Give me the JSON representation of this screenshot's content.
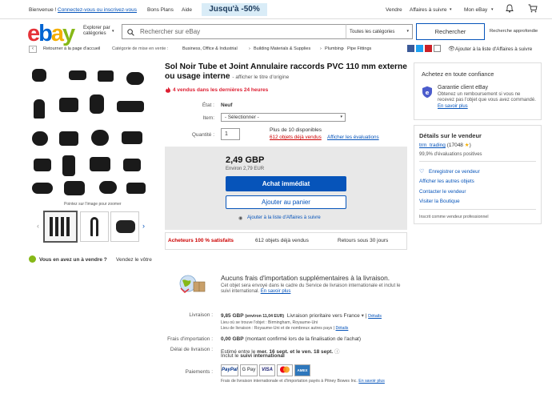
{
  "topbar": {
    "greeting": "Bienvenue !",
    "signin_link": "Connectez-vous ou inscrivez-vous",
    "deals": "Bons Plans",
    "help": "Aide",
    "promo": "Jusqu'à -50%",
    "sell": "Vendre",
    "watchlist": "Affaires à suivre",
    "my_ebay": "Mon eBay"
  },
  "header": {
    "logo": "ebay",
    "explore": "Explorer par catégories",
    "search_placeholder": "Rechercher sur eBay",
    "category": "Toutes les catégories",
    "search_button": "Rechercher",
    "advanced": "Recherche approfondie"
  },
  "breadcrumb": {
    "back": "Retourner à la page d'accueil",
    "prefix": "Catégorie de mise en vente :",
    "items": [
      "Business, Office & Industrial",
      "Building Materials & Supplies",
      "Plumbing",
      "Pipe Fittings"
    ],
    "add_watch": "Ajouter à la liste d'Affaires à suivre"
  },
  "gallery": {
    "zoom_hint": "Pointez sur l'image pour zoomer",
    "sell_question": "Vous en avez un à vendre ?",
    "sell_link": "Vendez le vôtre"
  },
  "item": {
    "title": "Sol Noir Tube et Joint Annulaire raccords PVC 110 mm externe ou usage interne",
    "show_title": "- afficher le titre d'origine",
    "sold_recent": "4 vendus dans les dernières 24 heures",
    "condition_label": "État :",
    "condition": "Neuf",
    "variant_label": "Item:",
    "variant_value": "- Sélectionner -",
    "qty_label": "Quantité :",
    "qty": "1",
    "available": "Plus de 10 disponibles",
    "sold_link": "612 objets déjà vendus",
    "reviews_link": "Afficher les évaluations",
    "price": "2,49 GBP",
    "price_approx": "Environ 2,79 EUR",
    "buy_now": "Achat immédiat",
    "add_cart": "Ajouter au panier",
    "add_watch": "Ajouter à la liste d'Affaires à suivre",
    "stat_satisfied": "Acheteurs 100 % satisfaits",
    "stat_sold": "612 objets déjà vendus",
    "stat_returns": "Retours sous 30 jours"
  },
  "confidence": {
    "title": "Achetez en toute confiance",
    "guarantee": "Garantie client eBay",
    "text": "Obtenez un remboursement si vous ne recevez pas l'objet que vous avez commandé.",
    "link": "En savoir plus"
  },
  "seller": {
    "title": "Détails sur le vendeur",
    "name": "trm_trading",
    "score": "(17048",
    "positive": "99,9% d'évaluations positives",
    "save": "Enregistrer ce vendeur",
    "other_items": "Afficher les autres objets",
    "contact": "Contacter le vendeur",
    "store": "Visiter la Boutique",
    "pro": "Inscrit comme vendeur professionnel"
  },
  "import": {
    "title": "Aucuns frais d'importation supplémentaires à la livraison.",
    "text": "Cet objet sera envoyé dans le cadre du Service de livraison internationale et inclut le suivi international.",
    "link": "En savoir plus"
  },
  "shipping": {
    "delivery_label": "Livraison :",
    "delivery_price": "9,85 GBP",
    "delivery_approx": "(environ 11,04 EUR)",
    "delivery_service": "Livraison prioritaire vers France",
    "details": "Détails",
    "location": "Lieu où se trouve l'objet : Birmingham, Royaume-Uni",
    "delivery_to": "Lieu de livraison : Royaume-Uni et de nombreux autres pays |",
    "delivery_details": "Détails",
    "import_label": "Frais d'importation :",
    "import_value": "0,00 GBP",
    "import_note": "(montant confirmé lors de la finalisation de l'achat)",
    "eta_label": "Délai de livraison :",
    "eta_pre": "Estimé entre le",
    "eta_dates": "mer. 16 sept. et le ven. 18 sept.",
    "eta_includes": "Inclut le",
    "eta_tracking": "suivi international",
    "payments_label": "Paiements :",
    "payment_methods": [
      "PayPal",
      "G Pay",
      "VISA",
      "MC",
      "AMEX"
    ],
    "payment_note": "Frais de livraison internationale et d'importation payés à Pitney Bowes Inc.",
    "payment_link": "En savoir plus"
  },
  "colors": {
    "ebay_red": "#e53238",
    "ebay_blue": "#0064d2",
    "ebay_yellow": "#f5af02",
    "ebay_green": "#86b817",
    "accent": "#0654ba",
    "alert_red": "#dd1e31"
  }
}
